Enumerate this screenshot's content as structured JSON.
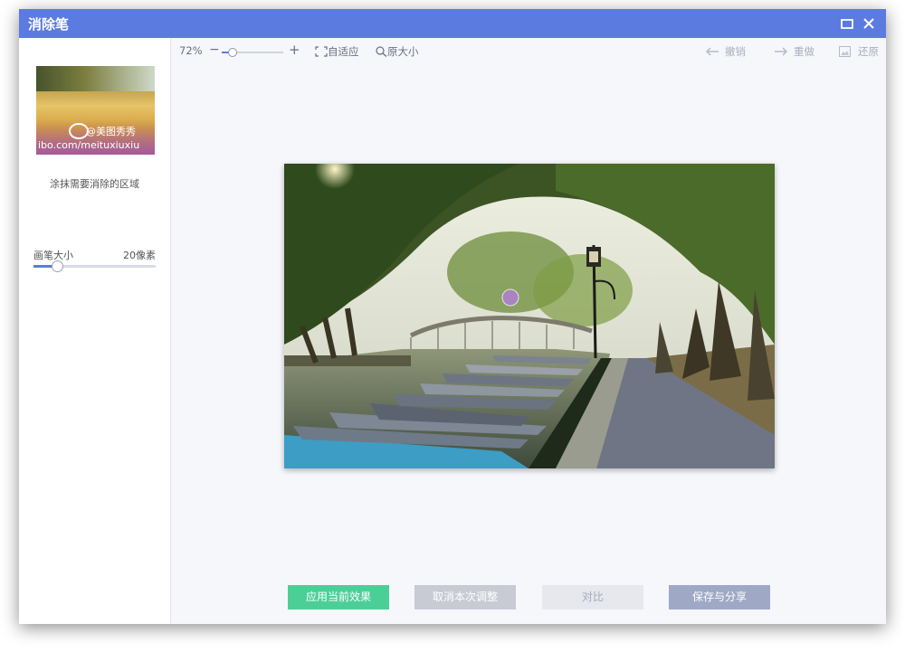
{
  "window": {
    "title": "消除笔"
  },
  "sidebar": {
    "thumb_watermark_handle": "@美图秀秀",
    "thumb_watermark_url": "ibo.com/meituxiuxiu",
    "hint": "涂抹需要消除的区域",
    "brush_label": "画笔大小",
    "brush_value": "20像素",
    "brush_level": 0.19
  },
  "toolbar": {
    "zoom_percent": "72%",
    "zoom_minus": "−",
    "zoom_plus": "+",
    "zoom_level": 0.18,
    "fit_label": "自适应",
    "original_size_label": "原大小",
    "undo_label": "撤销",
    "redo_label": "重做",
    "restore_label": "还原"
  },
  "actions": {
    "apply_label": "应用当前效果",
    "cancel_label": "取消本次调整",
    "compare_label": "对比",
    "save_label": "保存与分享"
  },
  "colors": {
    "titlebar": "#5b7be0",
    "apply": "#4ccf97",
    "cancel": "#c8cbd4",
    "compare": "#e6e8ee",
    "save": "#9fa9c6"
  }
}
